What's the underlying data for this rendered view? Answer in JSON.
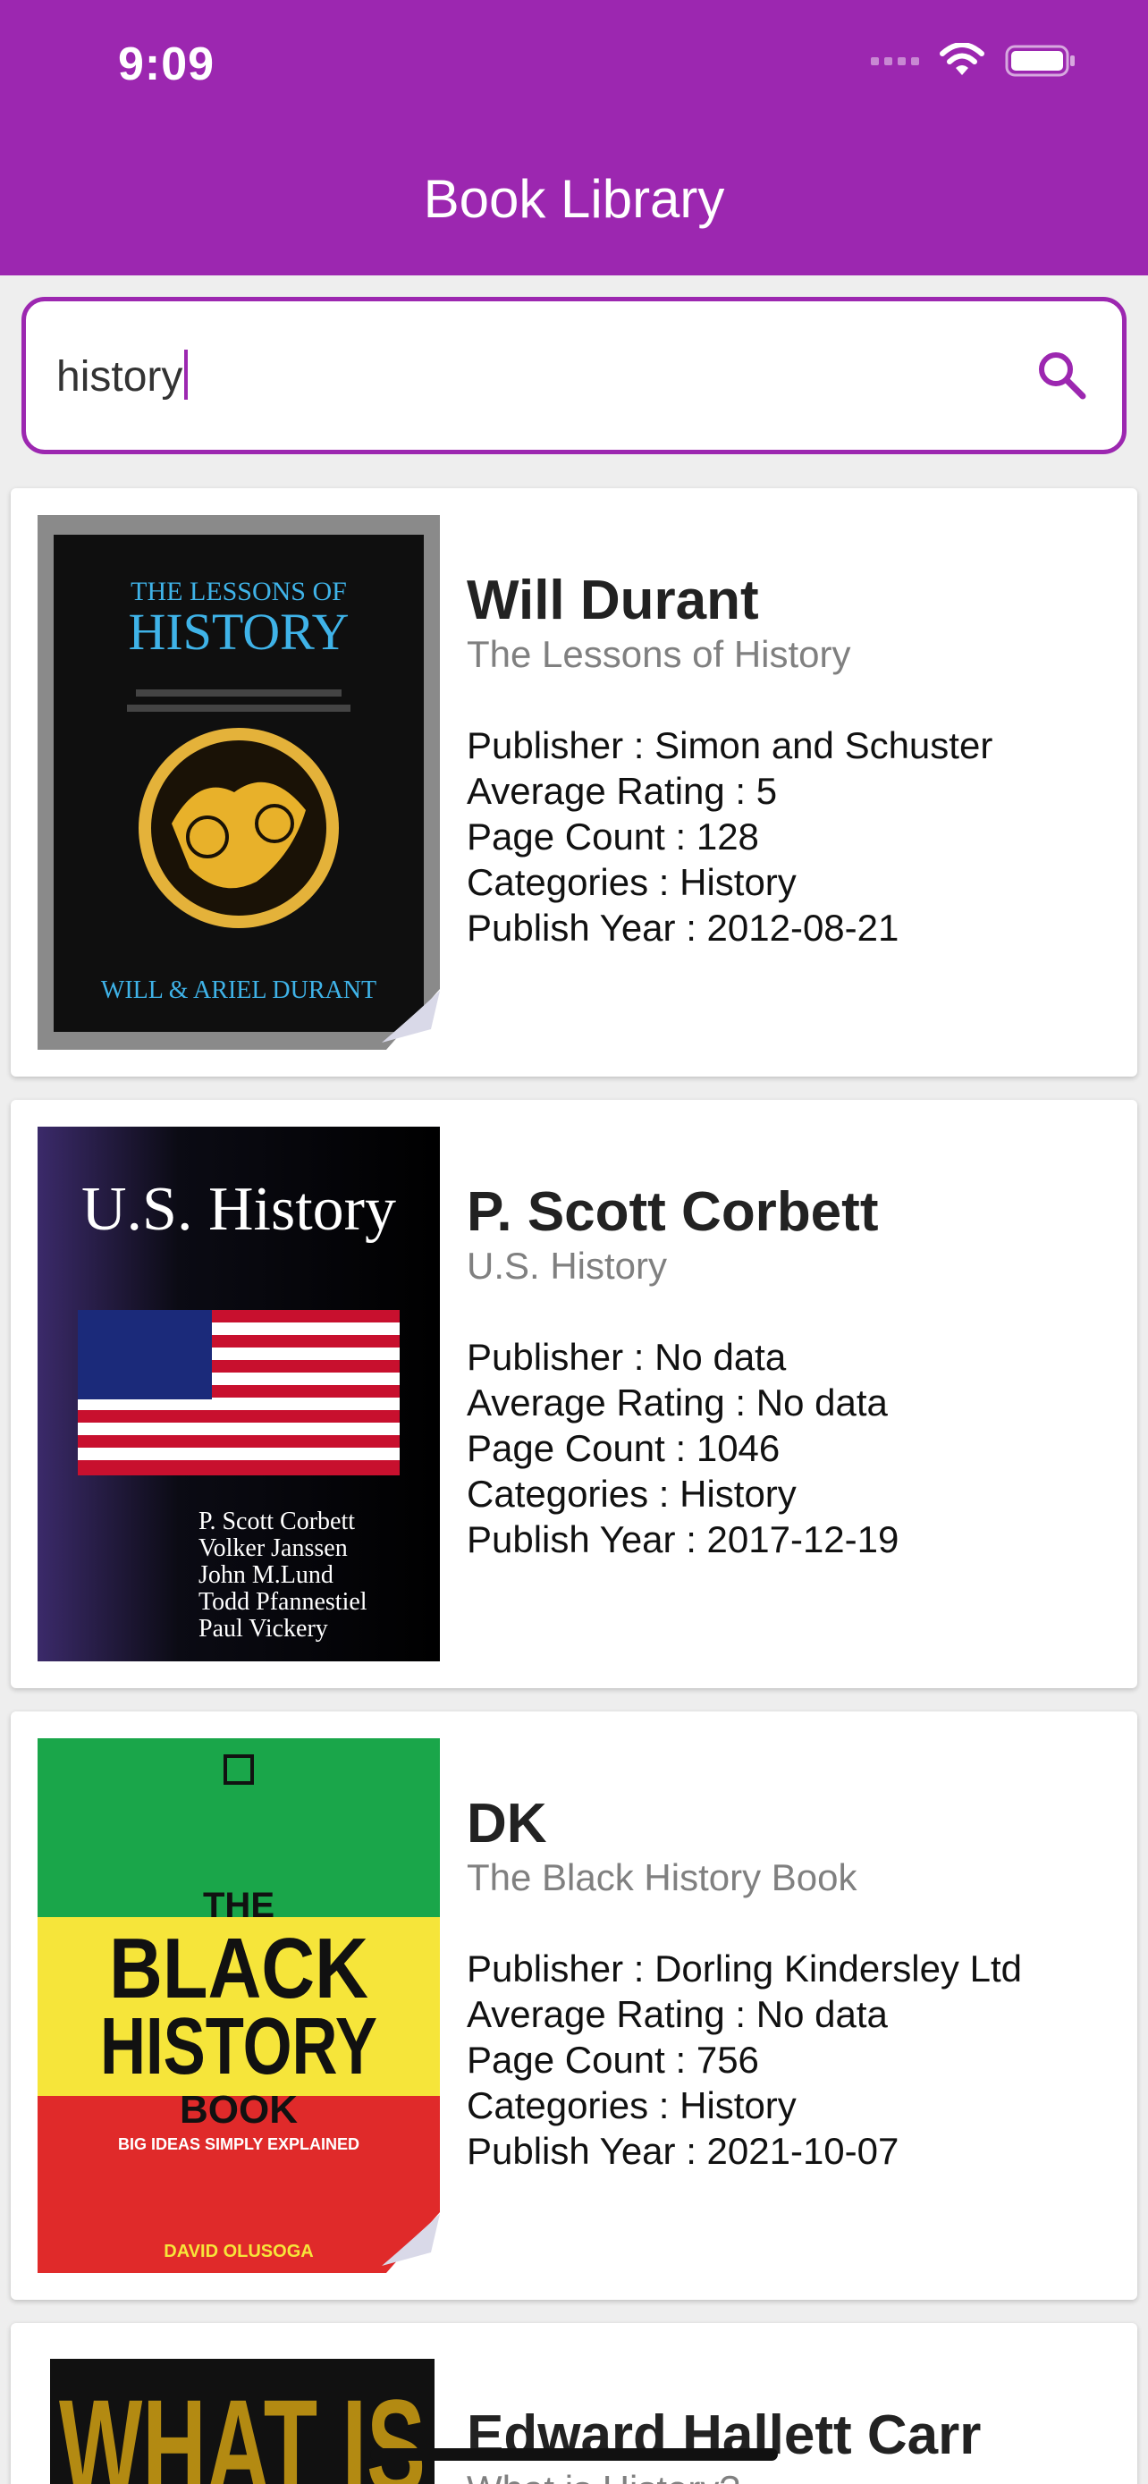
{
  "status_bar": {
    "time": "9:09"
  },
  "app_bar": {
    "title": "Book Library"
  },
  "search": {
    "value": "history"
  },
  "books": [
    {
      "author": "Will Durant",
      "title": "The Lessons of History",
      "publisher": "Publisher : Simon and Schuster",
      "rating": "Average Rating : 5",
      "pages": "Page Count : 128",
      "categories": "Categories : History",
      "year": "Publish Year : 2012-08-21",
      "cover": {
        "line1": "THE LESSONS OF",
        "line2": "HISTORY",
        "footer": "WILL & ARIEL DURANT"
      }
    },
    {
      "author": "P. Scott Corbett",
      "title": "U.S. History",
      "publisher": "Publisher : No data",
      "rating": "Average Rating : No data",
      "pages": "Page Count : 1046",
      "categories": "Categories : History",
      "year": "Publish Year : 2017-12-19",
      "cover": {
        "title": "U.S. History",
        "authors": [
          "P. Scott Corbett",
          "Volker Janssen",
          "John M.Lund",
          "Todd Pfannestiel",
          "Paul Vickery"
        ]
      }
    },
    {
      "author": "DK",
      "title": "The Black History Book",
      "publisher": "Publisher : Dorling Kindersley Ltd",
      "rating": "Average Rating : No data",
      "pages": "Page Count : 756",
      "categories": "Categories : History",
      "year": "Publish Year : 2021-10-07",
      "cover": {
        "line1": "THE",
        "line2": "BLACK",
        "line3": "HISTORY",
        "line4": "BOOK",
        "tagline": "BIG IDEAS SIMPLY EXPLAINED",
        "footer": "DAVID OLUSOGA"
      }
    },
    {
      "author": "Edward Hallett Carr",
      "title": "What is History?",
      "cover": {
        "text": "WHAT IS"
      }
    }
  ],
  "colors": {
    "accent": "#9c27b0",
    "background": "#eeeeee"
  }
}
